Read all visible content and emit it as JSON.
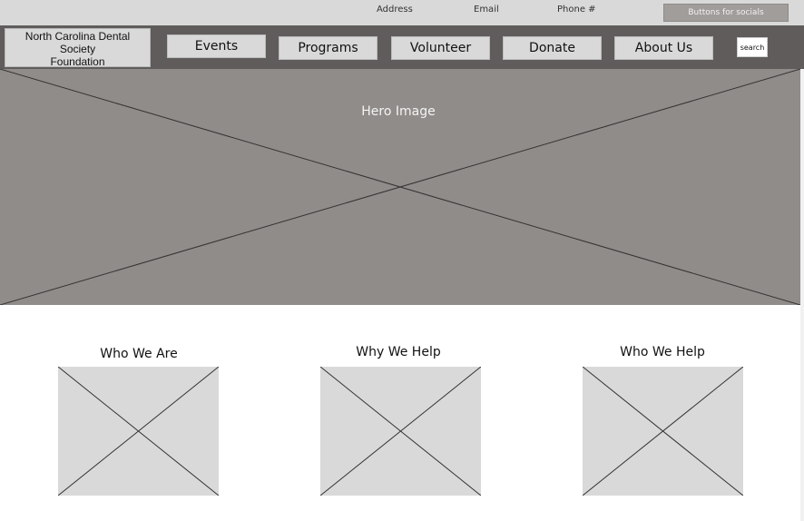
{
  "topbar": {
    "address": "Address",
    "email": "Email",
    "phone": "Phone #",
    "socials_button": "Buttons for socials"
  },
  "navbar": {
    "logo_lines": [
      "North Carolina Dental",
      "Society",
      "Foundation"
    ],
    "items": [
      {
        "label": "Events"
      },
      {
        "label": "Programs"
      },
      {
        "label": "Volunteer"
      },
      {
        "label": "Donate"
      },
      {
        "label": "About Us"
      }
    ],
    "search_label": "search"
  },
  "hero": {
    "label": "Hero Image"
  },
  "sections": [
    {
      "title": "Who We Are"
    },
    {
      "title": "Why We Help"
    },
    {
      "title": "Who We Help"
    }
  ],
  "colors": {
    "topbar": "#d9d9d9",
    "navbar": "#5f5c5b",
    "hero": "#908c8a",
    "placeholder": "#d9d9d9"
  }
}
